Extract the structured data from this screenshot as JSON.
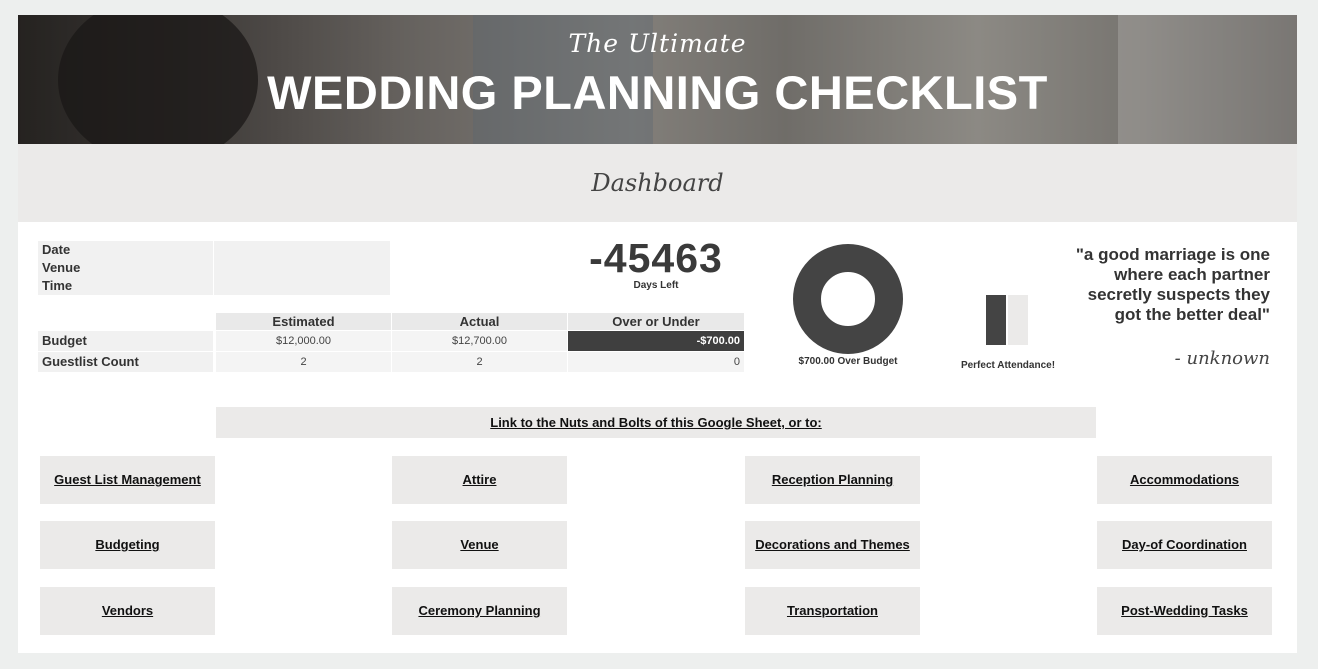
{
  "header": {
    "subtitle": "The Ultimate",
    "title": "WEDDING PLANNING CHECKLIST"
  },
  "dashboard": {
    "title": "Dashboard"
  },
  "info": {
    "rows": [
      {
        "label": "Date",
        "value": ""
      },
      {
        "label": "Venue",
        "value": ""
      },
      {
        "label": "Time",
        "value": ""
      }
    ]
  },
  "table": {
    "headers": [
      "Estimated",
      "Actual",
      "Over or Under"
    ],
    "rows": [
      {
        "label": "Budget",
        "values": [
          "$12,000.00",
          "$12,700.00",
          "-$700.00"
        ]
      },
      {
        "label": "Guestlist Count",
        "values": [
          "2",
          "2",
          "0"
        ]
      }
    ]
  },
  "countdown": {
    "value": "-45463",
    "label": "Days Left"
  },
  "budget_donut": {
    "caption": "$700.00 Over Budget",
    "color": "#444444"
  },
  "attendance": {
    "caption": "Perfect Attendance!",
    "values": [
      2,
      2
    ],
    "colors": [
      "#444444",
      "#ebeae9"
    ]
  },
  "quote": {
    "text": "\"a good marriage is one where each partner secretly suspects they got the better deal\"",
    "author": "- unknown"
  },
  "links": {
    "banner": "Link to the Nuts and Bolts of this Google Sheet, or to:",
    "buttons": [
      "Guest List Management",
      "Attire",
      "Reception Planning",
      "Accommodations",
      "Budgeting",
      "Venue",
      "Decorations and Themes",
      "Day-of Coordination",
      "Vendors",
      "Ceremony Planning",
      "Transportation",
      "Post-Wedding Tasks"
    ]
  }
}
